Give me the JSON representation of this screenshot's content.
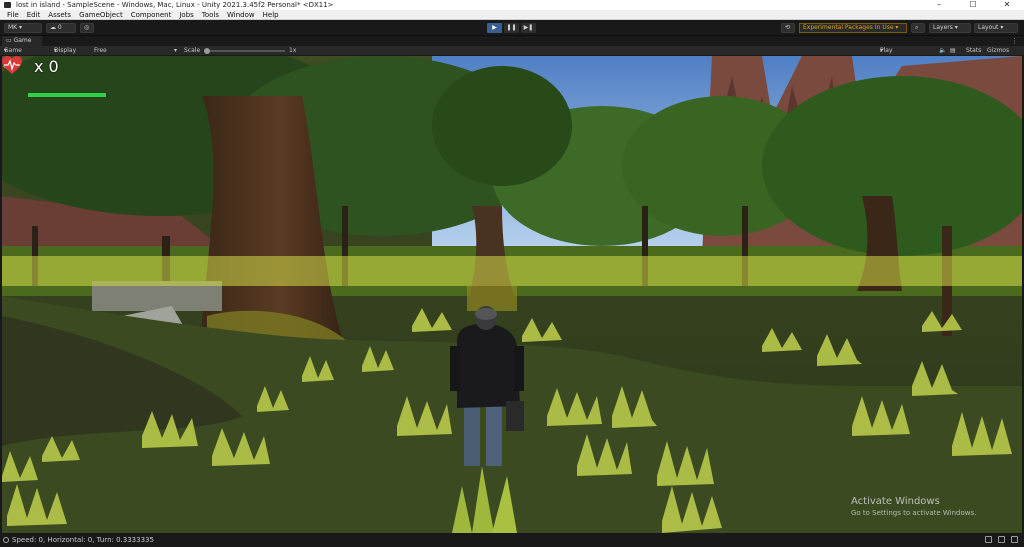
{
  "window": {
    "title": "lost in island - SampleScene - Windows, Mac, Linux - Unity 2021.3.45f2 Personal* <DX11>",
    "controls": [
      "–",
      "☐",
      "✕"
    ]
  },
  "menu": [
    "File",
    "Edit",
    "Assets",
    "GameObject",
    "Component",
    "Jobs",
    "Tools",
    "Window",
    "Help"
  ],
  "toolbar": {
    "account": "MK",
    "collab_count": "0",
    "experimental": "Experimental Packages In Use ▾",
    "layers": "Layers",
    "layout": "Layout"
  },
  "tab": {
    "label": "Game"
  },
  "gamebar": {
    "display_mode": "Game",
    "display": "Display 1",
    "aspect": "Free Aspect",
    "scale_label": "Scale",
    "scale_value": "1x",
    "play_mode": "Play Focused",
    "stats": "Stats",
    "gizmos": "Gizmos"
  },
  "hud": {
    "count": "x 0",
    "health": 0.97,
    "accent_color": "#2fd14a"
  },
  "watermark": {
    "line1": "Activate Windows",
    "line2": "Go to Settings to activate Windows."
  },
  "status": {
    "text": "Speed: 0, Horizontal: 0, Turn: 0.3333335"
  },
  "icons": [
    "unity-icon",
    "cloud-icon",
    "play-icon",
    "pause-icon",
    "step-icon",
    "history-icon",
    "search-icon",
    "coin-icon",
    "heart-icon"
  ]
}
